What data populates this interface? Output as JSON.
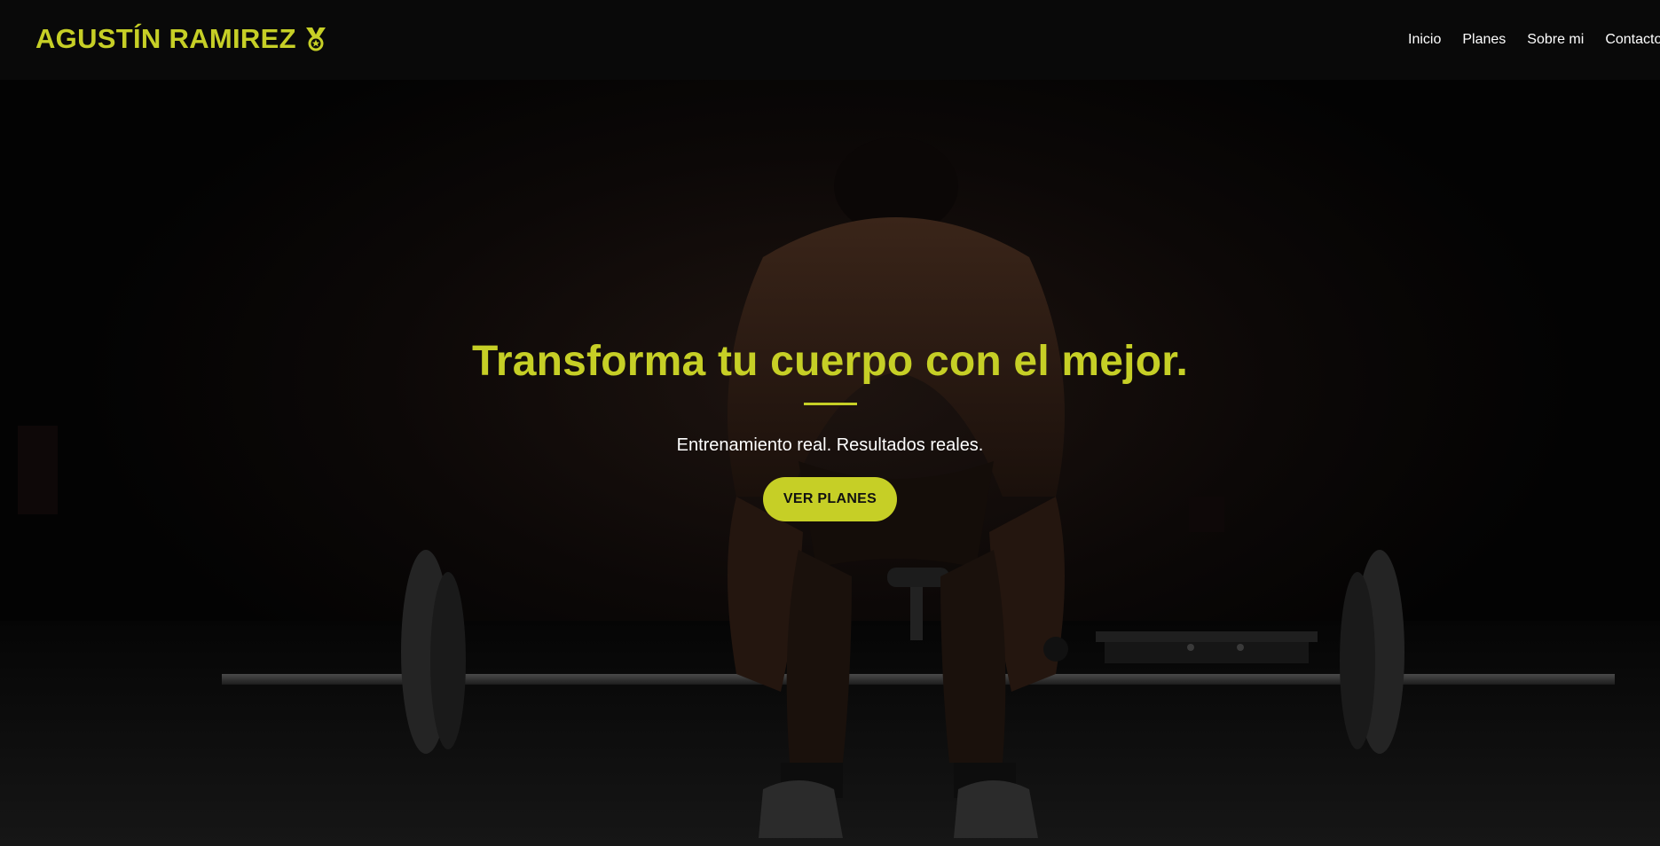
{
  "header": {
    "brand": "AGUSTÍN RAMIREZ",
    "brand_icon": "medal-icon",
    "nav": [
      {
        "label": "Inicio"
      },
      {
        "label": "Planes"
      },
      {
        "label": "Sobre mi"
      },
      {
        "label": "Contacto"
      }
    ]
  },
  "hero": {
    "title": "Transforma tu cuerpo con el mejor.",
    "subtitle": "Entrenamiento real. Resultados reales.",
    "cta_label": "VER PLANES",
    "background": "athlete-deadlift-photo"
  },
  "colors": {
    "accent": "#c6cf26",
    "background": "#030303",
    "header_bg": "#0a0a0a",
    "text": "#ffffff"
  }
}
